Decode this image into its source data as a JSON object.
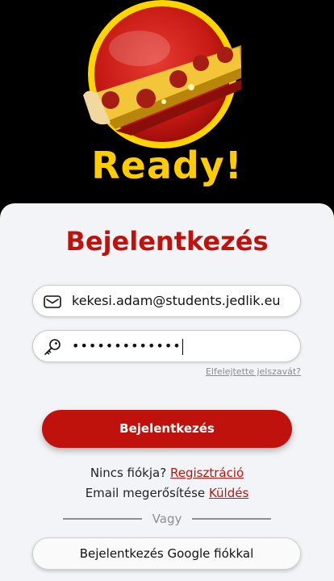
{
  "hero": {
    "brand_text": "Ready!",
    "logo_icon": "pizza-slice-logo"
  },
  "form": {
    "title": "Bejelentkezés",
    "email": {
      "value": "kekesi.adam@students.jedlik.eu",
      "icon": "mail-icon"
    },
    "password": {
      "value": "•••••••••••••",
      "icon": "key-icon"
    },
    "forgot_link": "Elfelejtette jelszavát?",
    "login_button": "Bejelentkezés",
    "register_prompt": "Nincs fiókja?",
    "register_link": "Regisztráció",
    "verify_prompt": "Email megerősítése",
    "verify_link": "Küldés",
    "divider_text": "Vagy",
    "google_button": "Bejelentkezés Google fiókkal"
  },
  "colors": {
    "brand_red": "#c0120c",
    "brand_yellow": "#ffcc00",
    "background": "#000000",
    "card": "#f2f4f7"
  }
}
